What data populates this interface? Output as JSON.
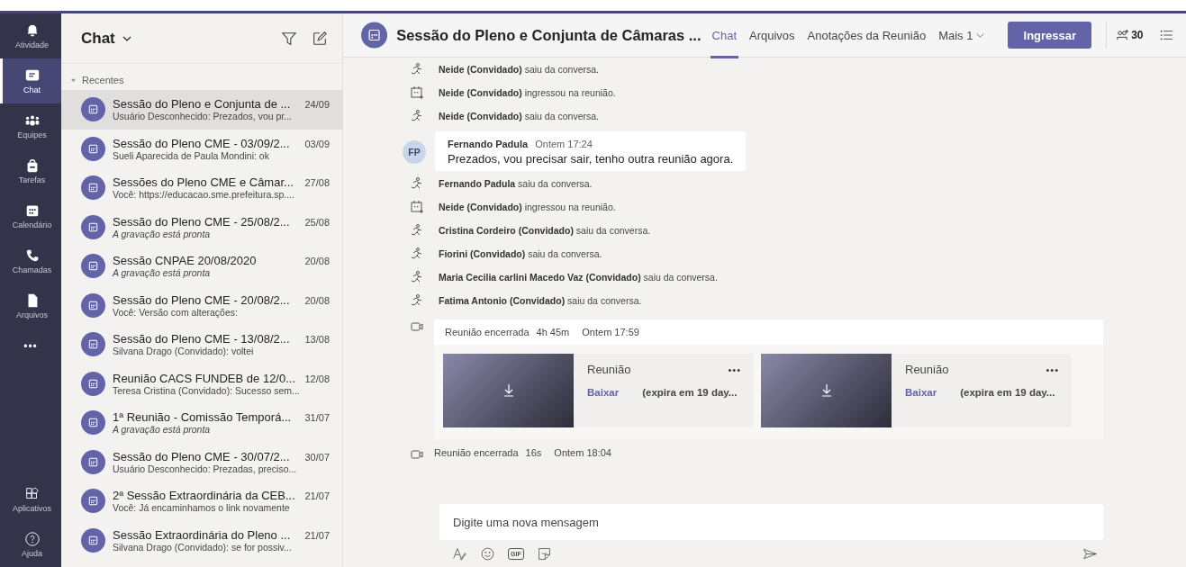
{
  "rail": {
    "items": [
      {
        "label": "Atividade",
        "selected": false
      },
      {
        "label": "Chat",
        "selected": true
      },
      {
        "label": "Equipes",
        "selected": false
      },
      {
        "label": "Tarefas",
        "selected": false
      },
      {
        "label": "Calendário",
        "selected": false
      },
      {
        "label": "Chamadas",
        "selected": false
      },
      {
        "label": "Arquivos",
        "selected": false
      }
    ],
    "more": "•••",
    "bottom_items": [
      {
        "label": "Aplicativos",
        "selected": false
      },
      {
        "label": "Ajuda",
        "selected": false
      }
    ]
  },
  "chat_list": {
    "title": "Chat",
    "section": "Recentes",
    "items": [
      {
        "title": "Sessão do Pleno e Conjunta de ...",
        "date": "24/09",
        "preview": "Usuário Desconhecido: Prezados, vou pr...",
        "italic": false,
        "selected": true
      },
      {
        "title": "Sessão do Pleno CME - 03/09/2...",
        "date": "03/09",
        "preview": "Sueli Aparecida de Paula Mondini: ok",
        "italic": false,
        "selected": false
      },
      {
        "title": "Sessões do Pleno CME e Câmar...",
        "date": "27/08",
        "preview": "Você: https://educacao.sme.prefeitura.sp....",
        "italic": false,
        "selected": false
      },
      {
        "title": "Sessão do Pleno CME - 25/08/2...",
        "date": "25/08",
        "preview": "A gravação está pronta",
        "italic": true,
        "selected": false
      },
      {
        "title": "Sessão CNPAE 20/08/2020",
        "date": "20/08",
        "preview": "A gravação está pronta",
        "italic": true,
        "selected": false
      },
      {
        "title": "Sessão do Pleno CME - 20/08/2...",
        "date": "20/08",
        "preview": "Você: Versão com alterações:",
        "italic": false,
        "selected": false
      },
      {
        "title": "Sessão do Pleno CME - 13/08/2...",
        "date": "13/08",
        "preview": "Silvana Drago (Convidado): voltei",
        "italic": false,
        "selected": false
      },
      {
        "title": "Reunião CACS FUNDEB de 12/0...",
        "date": "12/08",
        "preview": "Teresa Cristina (Convidado): Sucesso sem...",
        "italic": false,
        "selected": false
      },
      {
        "title": "1ª Reunião - Comissão Temporá...",
        "date": "31/07",
        "preview": "A gravação está pronta",
        "italic": true,
        "selected": false
      },
      {
        "title": "Sessão do Pleno CME - 30/07/2...",
        "date": "30/07",
        "preview": "Usuário Desconhecido: Prezadas, preciso...",
        "italic": false,
        "selected": false
      },
      {
        "title": "2ª Sessão Extraordinária da CEB...",
        "date": "21/07",
        "preview": "Você: Já encaminhamos o link novamente",
        "italic": false,
        "selected": false
      },
      {
        "title": "Sessão Extraordinária do Pleno ...",
        "date": "21/07",
        "preview": "Silvana Drago (Convidado): se for possiv...",
        "italic": false,
        "selected": false
      }
    ]
  },
  "header": {
    "title": "Sessão do Pleno e Conjunta de Câmaras ...",
    "tabs": [
      {
        "label": "Chat",
        "selected": true
      },
      {
        "label": "Arquivos",
        "selected": false
      },
      {
        "label": "Anotações da Reunião",
        "selected": false
      },
      {
        "label": "Mais 1",
        "selected": false
      }
    ],
    "join_button": "Ingressar",
    "participants": "30"
  },
  "messages": [
    {
      "kind": "left",
      "text": "**Neide (Convidado)** saiu da conversa."
    },
    {
      "kind": "joined",
      "text": "**Neide (Convidado)** ingressou na reunião."
    },
    {
      "kind": "left",
      "text": "**Neide (Convidado)** saiu da conversa."
    },
    {
      "kind": "post",
      "initials": "FP",
      "author": "Fernando Padula",
      "time": "Ontem 17:24",
      "text": "Prezados, vou precisar sair, tenho outra reunião agora."
    },
    {
      "kind": "left",
      "text": "**Fernando Padula** saiu da conversa."
    },
    {
      "kind": "joined",
      "text": "**Neide (Convidado)** ingressou na reunião."
    },
    {
      "kind": "left",
      "text": "**Cristina Cordeiro (Convidado)** saiu da conversa."
    },
    {
      "kind": "left",
      "text": "**Fiorini (Convidado)** saiu da conversa."
    },
    {
      "kind": "left",
      "text": "**Maria Cecilia carlini Macedo Vaz (Convidado)** saiu da conversa."
    },
    {
      "kind": "left",
      "text": "**Fatima Antonio (Convidado)** saiu da conversa."
    },
    {
      "kind": "meeting_ended",
      "status": "Reunião encerrada",
      "duration": "4h 45m",
      "time": "Ontem 17:59",
      "recordings": [
        {
          "title": "Reunião",
          "menu": "•••",
          "link": "Baixar",
          "expiry": "(expira em 19 day..."
        },
        {
          "title": "Reunião",
          "menu": "•••",
          "link": "Baixar",
          "expiry": "(expira em 19 day..."
        }
      ]
    },
    {
      "kind": "meeting_ended",
      "status": "Reunião encerrada",
      "duration": "16s",
      "time": "Ontem 18:04"
    }
  ],
  "composer": {
    "placeholder": "Digite uma nova mensagem",
    "gif_label": "GIF"
  }
}
